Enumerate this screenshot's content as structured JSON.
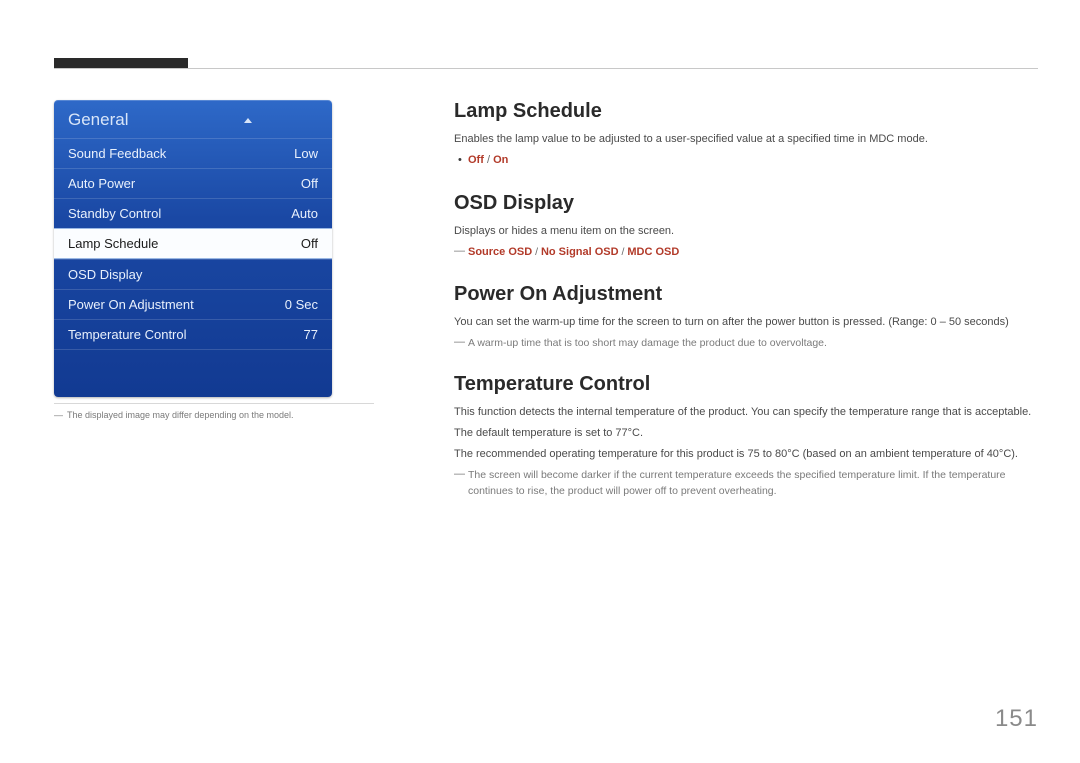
{
  "page_number": "151",
  "osd": {
    "title": "General",
    "items": [
      {
        "label": "Sound Feedback",
        "value": "Low",
        "selected": false
      },
      {
        "label": "Auto Power",
        "value": "Off",
        "selected": false
      },
      {
        "label": "Standby Control",
        "value": "Auto",
        "selected": false
      },
      {
        "label": "Lamp Schedule",
        "value": "Off",
        "selected": true
      },
      {
        "label": "OSD Display",
        "value": "",
        "selected": false
      },
      {
        "label": "Power On Adjustment",
        "value": "0 Sec",
        "selected": false
      },
      {
        "label": "Temperature Control",
        "value": "77",
        "selected": false
      }
    ],
    "caption": "The displayed image may differ depending on the model."
  },
  "sections": {
    "lamp": {
      "title": "Lamp Schedule",
      "desc": "Enables the lamp value to be adjusted to a user-specified value at a specified time in MDC mode.",
      "opt1": "Off",
      "opt2": "On"
    },
    "osd": {
      "title": "OSD Display",
      "desc": "Displays or hides a menu item on the screen.",
      "opt1": "Source OSD",
      "opt2": "No Signal OSD",
      "opt3": "MDC OSD"
    },
    "power": {
      "title": "Power On Adjustment",
      "desc": "You can set the warm-up time for the screen to turn on after the power button is pressed. (Range: 0 – 50 seconds)",
      "note": "A warm-up time that is too short may damage the product due to overvoltage."
    },
    "temp": {
      "title": "Temperature Control",
      "desc1": "This function detects the internal temperature of the product. You can specify the temperature range that is acceptable.",
      "desc2": "The default temperature is set to 77°C.",
      "desc3": "The recommended operating temperature for this product is 75 to 80°C (based on an ambient temperature of 40°C).",
      "note": "The screen will become darker if the current temperature exceeds the specified temperature limit. If the temperature continues to rise, the product will power off to prevent overheating."
    }
  }
}
